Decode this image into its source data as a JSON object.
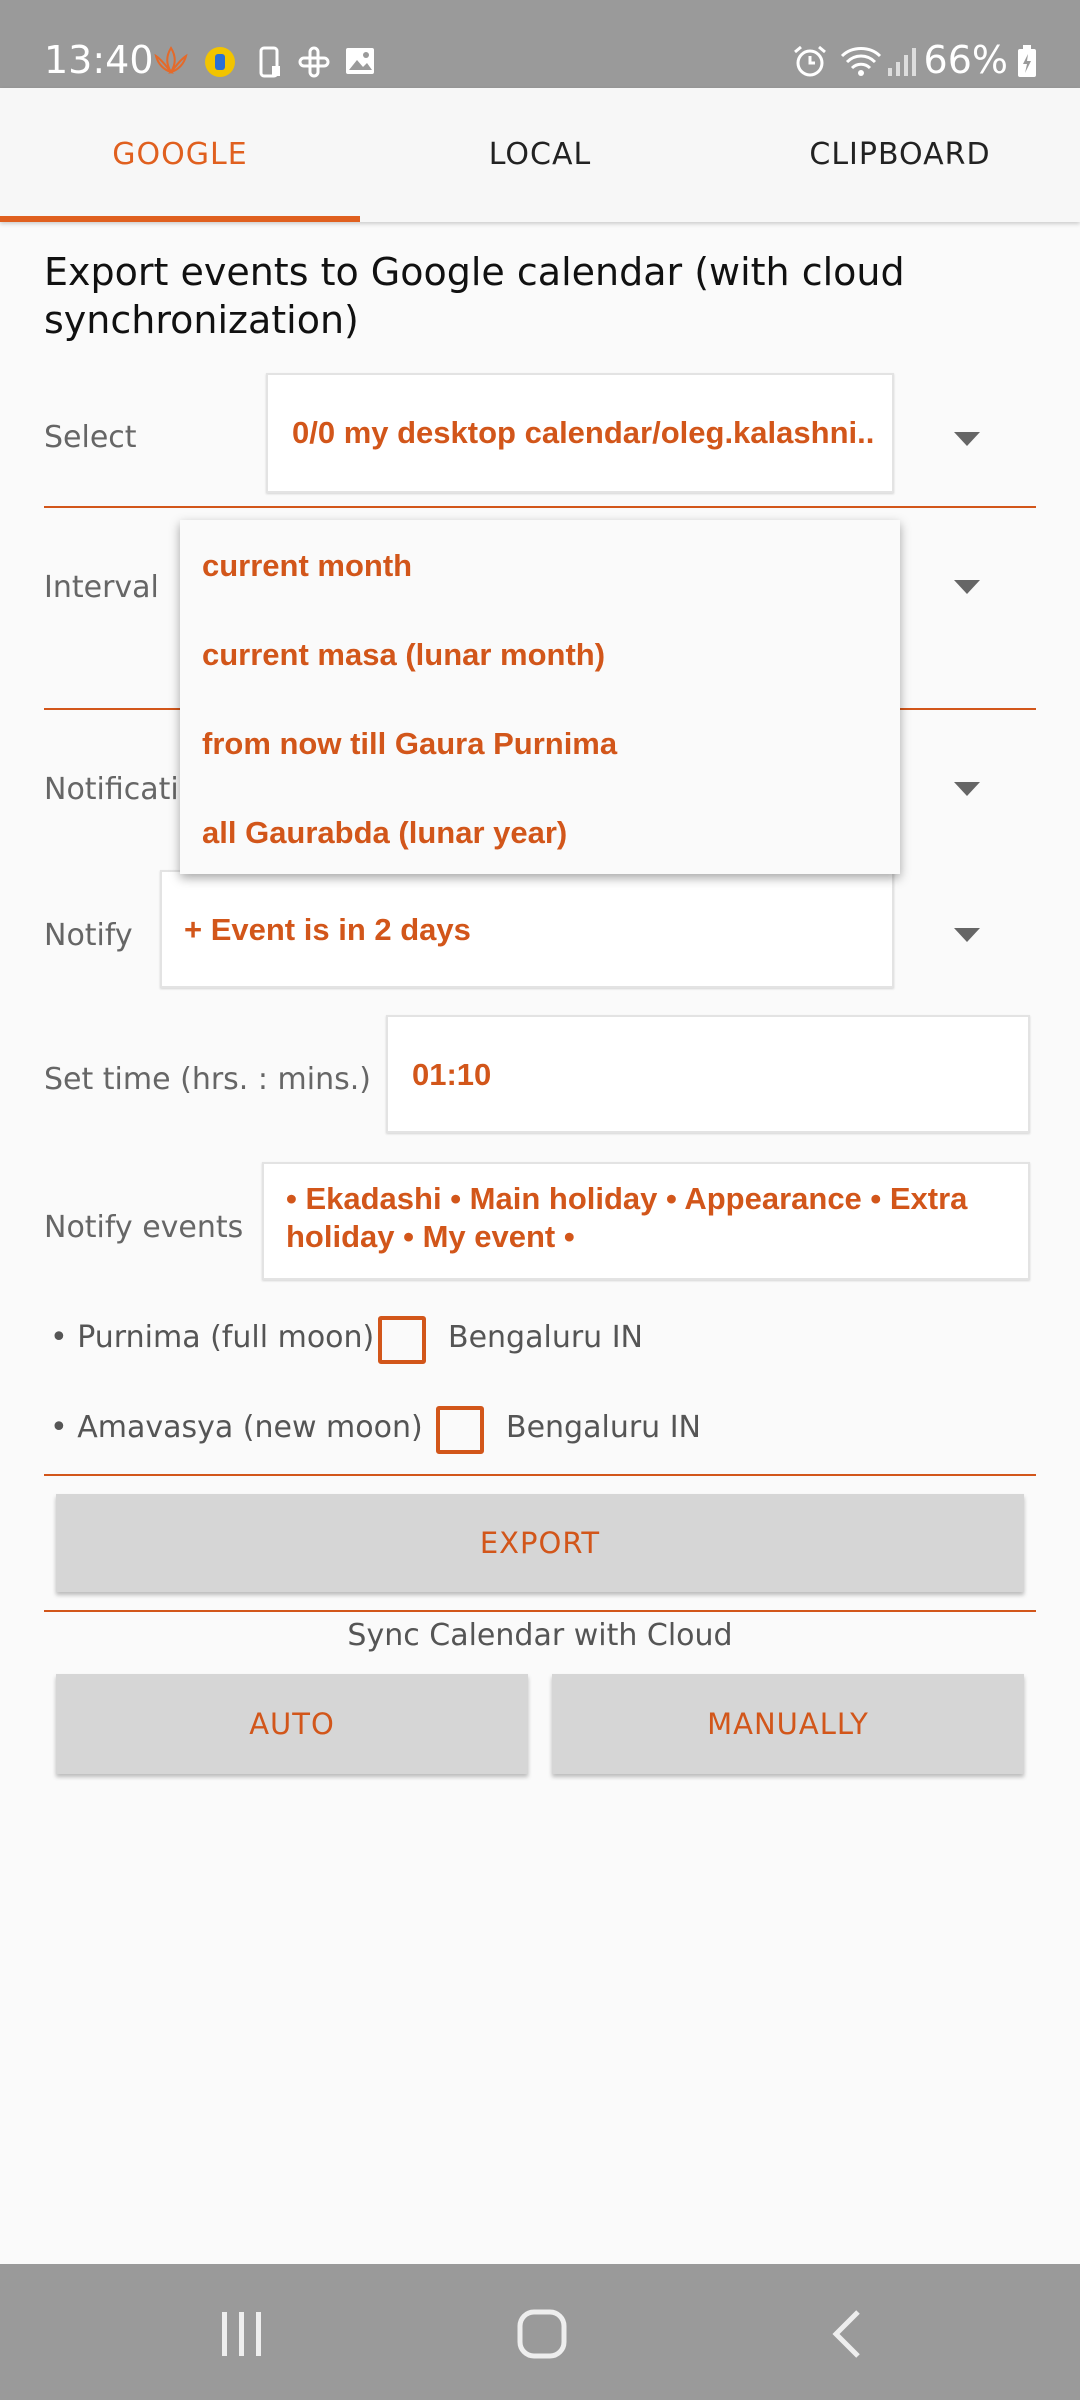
{
  "status_bar": {
    "time": "13:40",
    "battery": "66%",
    "icons": [
      "lotus-icon",
      "app-badge-icon",
      "device-icon",
      "slack-icon",
      "gallery-icon",
      "alarm-icon",
      "wifi-icon",
      "signal-icon",
      "battery-icon"
    ]
  },
  "tabs": [
    {
      "label": "GOOGLE",
      "active": true
    },
    {
      "label": "LOCAL",
      "active": false
    },
    {
      "label": "CLIPBOARD",
      "active": false
    }
  ],
  "heading": "Export events to Google calendar (with cloud synchronization)",
  "select": {
    "label": "Select",
    "value": "0/0 my desktop calendar/oleg.kalashni.."
  },
  "interval": {
    "label": "Interval",
    "options": [
      "current month",
      "current masa (lunar month)",
      "from now till Gaura Purnima",
      "all Gaurabda (lunar year)"
    ]
  },
  "notification": {
    "label": "Notificati"
  },
  "notify": {
    "label": "Notify",
    "value": "+ Event is in 2 days"
  },
  "set_time": {
    "label": "Set time (hrs. : mins.)",
    "value": "01:10"
  },
  "notify_events": {
    "label": "Notify events",
    "value": " • Ekadashi  • Main holiday  • Appearance  • Extra holiday  • My event •"
  },
  "purnima": {
    "label": "• Purnima (full moon)",
    "city": "Bengaluru IN",
    "checked": false
  },
  "amavasya": {
    "label": "• Amavasya (new moon)",
    "city": "Bengaluru IN",
    "checked": false
  },
  "export_button": "EXPORT",
  "sync_label": "Sync Calendar with Cloud",
  "auto_button": "AUTO",
  "manually_button": "MANUALLY",
  "colors": {
    "accent": "#d2561a",
    "tab_active": "#e0601f",
    "system_bars": "#9a9a9a"
  },
  "nav_bar": {
    "icons": [
      "recent-apps-icon",
      "home-icon",
      "back-icon"
    ]
  }
}
